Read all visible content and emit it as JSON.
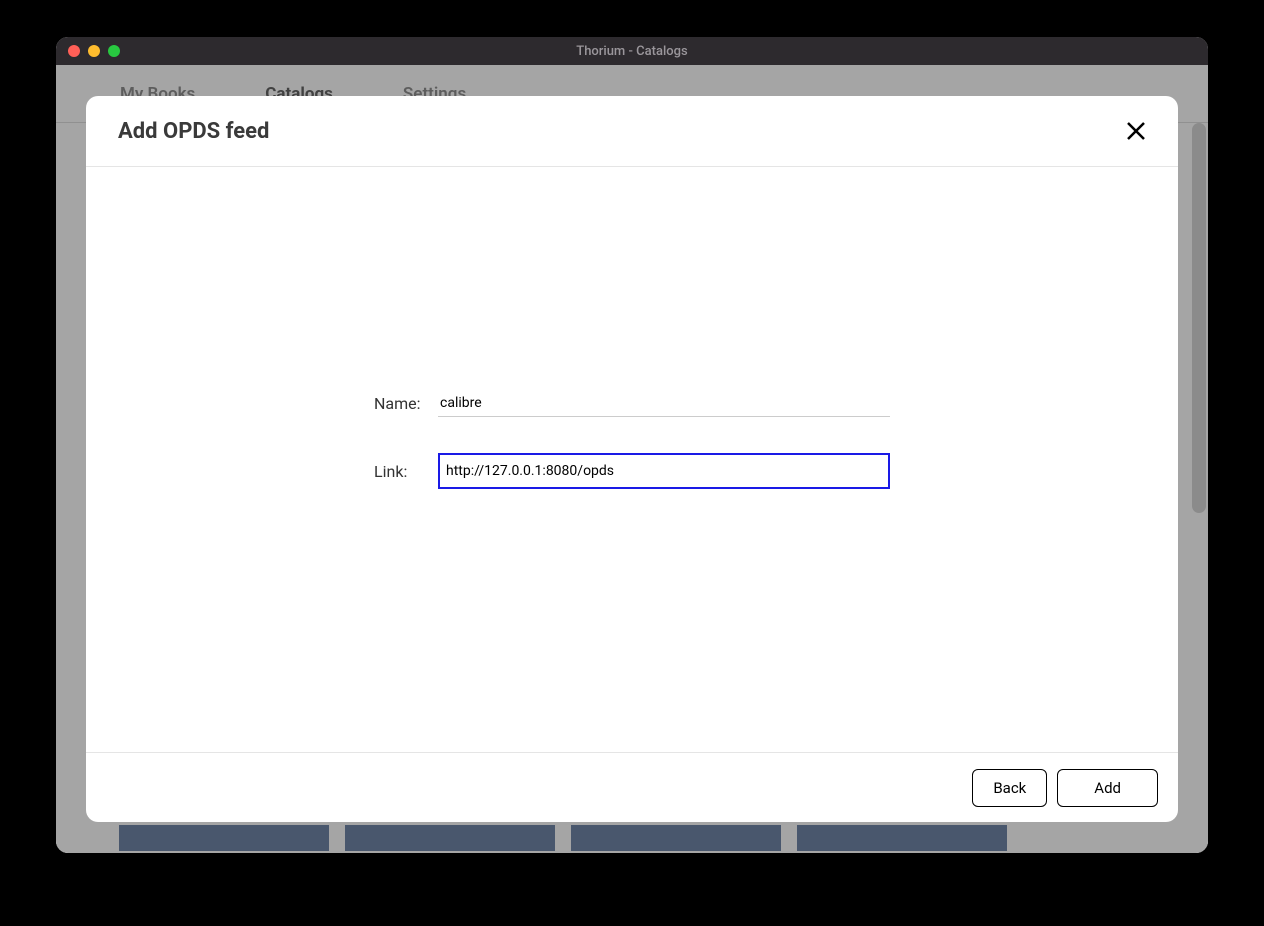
{
  "window": {
    "title": "Thorium - Catalogs"
  },
  "nav": {
    "tabs": [
      {
        "label": "My Books",
        "active": false
      },
      {
        "label": "Catalogs",
        "active": true
      },
      {
        "label": "Settings",
        "active": false
      }
    ]
  },
  "modal": {
    "title": "Add OPDS feed",
    "fields": {
      "name_label": "Name:",
      "name_value": "calibre",
      "link_label": "Link:",
      "link_value": "http://127.0.0.1:8080/opds"
    },
    "buttons": {
      "back": "Back",
      "add": "Add"
    }
  }
}
